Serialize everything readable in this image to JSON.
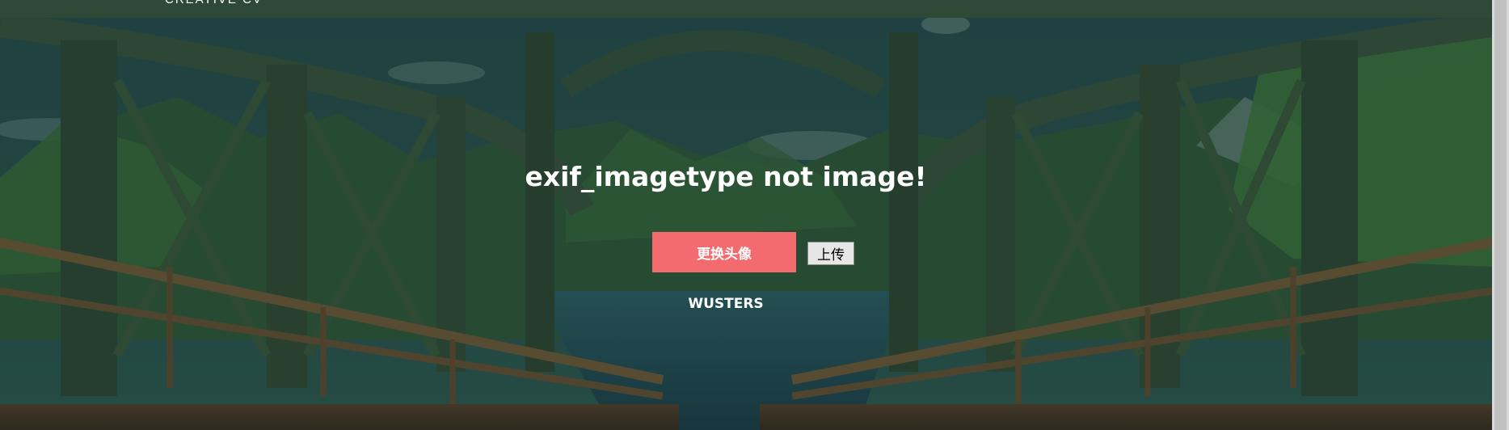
{
  "header": {
    "brand_text": "CREATIVE CV"
  },
  "main": {
    "message": "exif_imagetype not image!",
    "change_avatar_label": "更换头像",
    "upload_label": "上传",
    "username": "WUSTERS"
  },
  "background": {
    "scene": "bridge-over-mountain-lake"
  },
  "colors": {
    "accent": "#f36a6f",
    "overlay": "#1f3b3a",
    "text": "#ffffff"
  }
}
